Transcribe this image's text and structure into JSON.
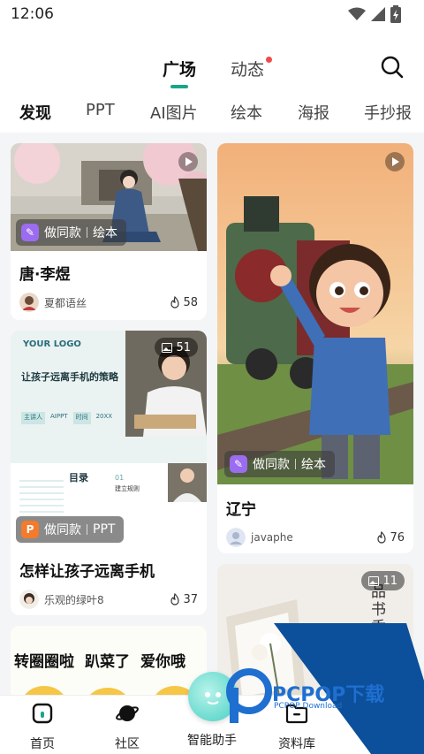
{
  "status": {
    "time": "12:06"
  },
  "top_tabs": [
    {
      "label": "广场"
    },
    {
      "label": "动态"
    }
  ],
  "categories": [
    "发现",
    "PPT",
    "AI图片",
    "绘本",
    "海报",
    "手抄报"
  ],
  "cards": {
    "tang": {
      "title": "唐·李煜",
      "author": "夏都语丝",
      "likes": "58",
      "action": "做同款",
      "type": "绘本"
    },
    "liaoning": {
      "title": "辽宁",
      "author": "javaphe",
      "likes": "76",
      "action": "做同款",
      "type": "绘本"
    },
    "ppt": {
      "title": "怎样让孩子远离手机",
      "author": "乐观的绿叶8",
      "likes": "37",
      "action": "做同款",
      "type": "PPT",
      "image_count": "51",
      "slide_logo": "YOUR LOGO",
      "slide_heading": "让孩子远离手机的策略",
      "slide_chip1": "主讲人",
      "slide_chip1_val": "AIPPT",
      "slide_chip2": "时间",
      "slide_chip2_val": "20XX",
      "slide_toc": "目录",
      "slide_num": "01",
      "slide_sub": "建立规则"
    },
    "book": {
      "image_count": "11",
      "vertical_text": "品书香"
    },
    "sticker": {
      "line1": "转圈圈啦",
      "line2": "趴菜了",
      "line3": "爱你哦"
    }
  },
  "bottom_nav": [
    {
      "label": "首页"
    },
    {
      "label": "社区"
    },
    {
      "label": "智能助手"
    },
    {
      "label": "资料库"
    }
  ],
  "watermark": {
    "brand": "PCPOP下载",
    "sub": "PCPOP Download"
  },
  "colors": {
    "accent": "#1aa58a",
    "purple_badge": "#9b6cf0",
    "orange_badge": "#f47a2c"
  }
}
